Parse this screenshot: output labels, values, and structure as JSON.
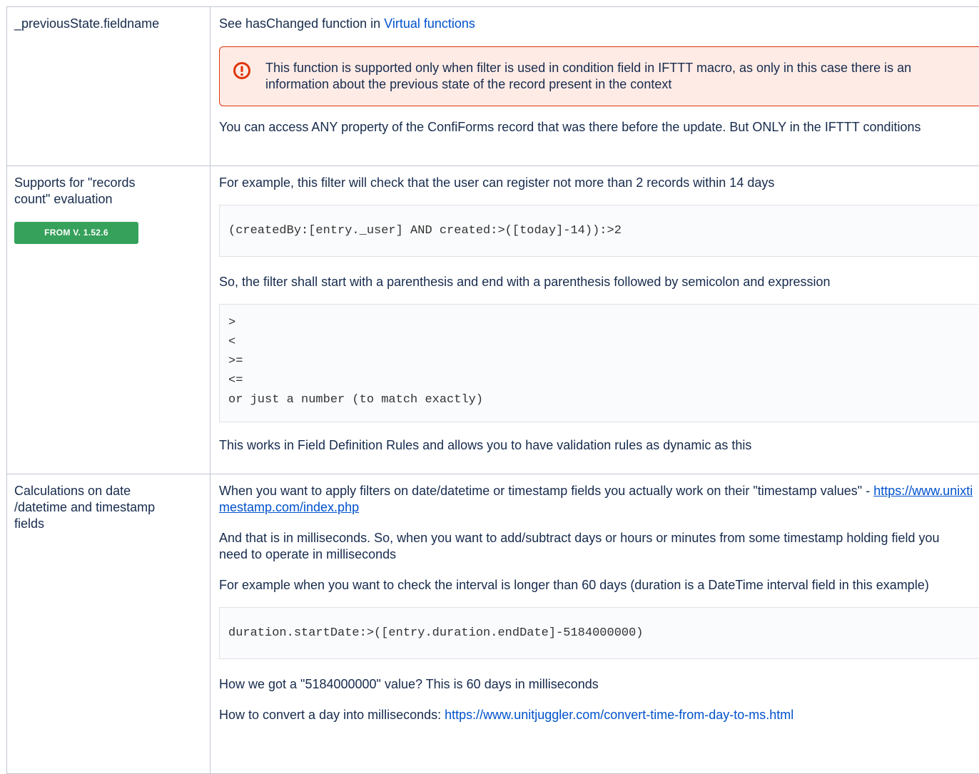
{
  "rows": [
    {
      "name": "_previousState.fieldname",
      "desc_prefix": "See hasChanged function in ",
      "desc_link": "Virtual functions",
      "error_text": "This function is supported only when filter is used in condition field in IFTTT macro, as only in this case there is an information about the previous state of the record present in the context",
      "note": "You can access ANY property of the ConfiForms record that was there before the update. But ONLY in the IFTTT conditions"
    },
    {
      "name": "Supports for \"records count\" evaluation",
      "badge": "FROM V. 1.52.6",
      "p1": "For example, this filter will check that the user can register not more than 2 records within 14 days",
      "code1": "(createdBy:[entry._user] AND created:>([today]-14)):>2",
      "p2": "So, the filter shall start with a parenthesis and end with a parenthesis followed by semicolon and expression",
      "code2": ">\n<\n>=\n<=\nor just a number (to match exactly)",
      "p3": "This works in Field Definition Rules and allows you to have validation rules as dynamic as this"
    },
    {
      "name": "Calculations on date /datetime and timestamp fields",
      "p1_prefix": "When you want to apply filters on date/datetime or timestamp fields you actually work on their \"timestamp values\" - ",
      "p1_link": "https://www.unixtimestamp.com/index.php",
      "p2": "And that is in milliseconds. So, when you want to add/subtract days or hours or minutes from some timestamp holding field you need to operate in milliseconds",
      "p3": "For example when you want to check the interval is longer than 60 days (duration is a DateTime interval field in this example)",
      "code1": "duration.startDate:>([entry.duration.endDate]-5184000000)",
      "p4": "How we got a \"5184000000\" value? This is 60 days in milliseconds",
      "p5_prefix": "How to convert a day into milliseconds: ",
      "p5_link": "https://www.unitjuggler.com/convert-time-from-day-to-ms.html"
    }
  ],
  "colors": {
    "link": "#0052cc",
    "error_border": "#de350b",
    "error_bg": "#ffebe6",
    "badge_bg": "#36a15a",
    "border": "#c1c7d0"
  },
  "icons": {
    "error": "error-icon"
  }
}
